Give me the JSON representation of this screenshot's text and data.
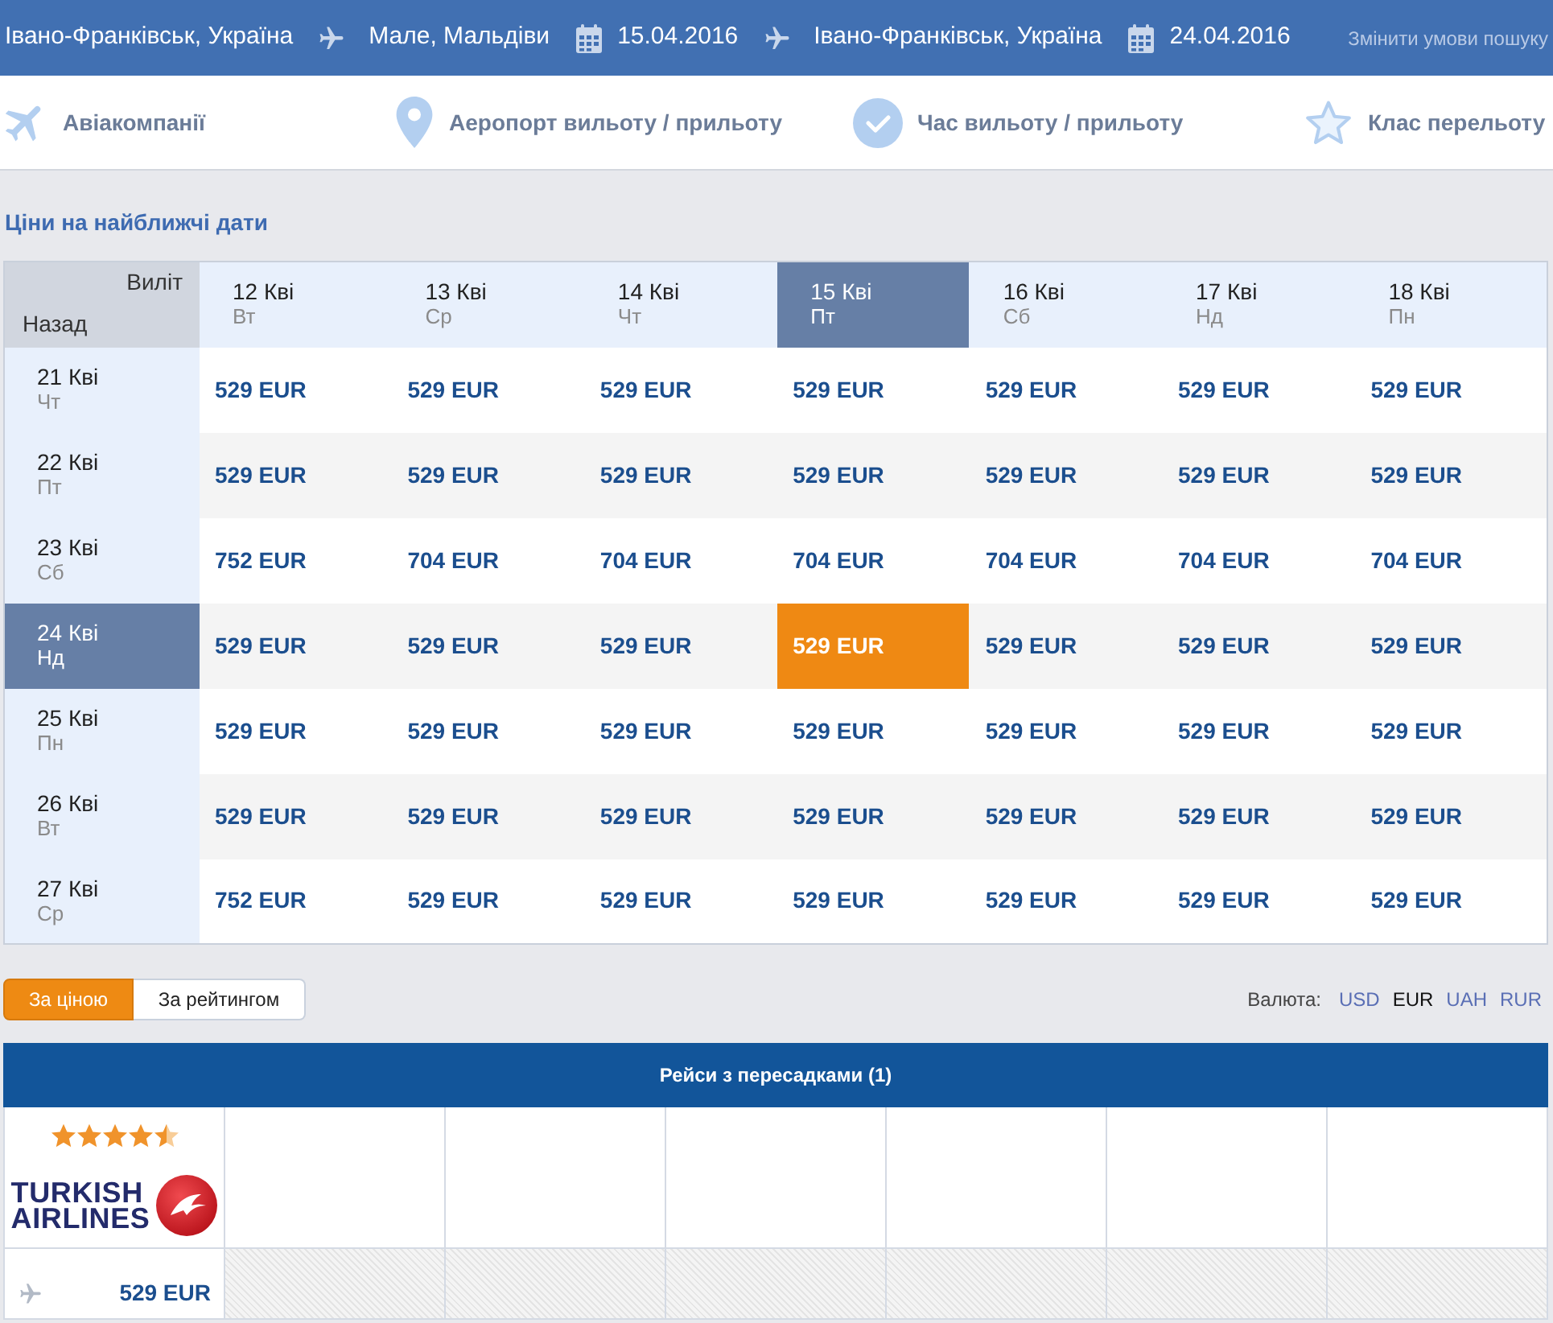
{
  "search_bar": {
    "origin": "Івано-Франківськ, Україна",
    "legs": [
      {
        "destination": "Мале, Мальдіви",
        "date": "15.04.2016"
      },
      {
        "destination": "Івано-Франківськ, Україна",
        "date": "24.04.2016"
      }
    ],
    "change_search": "Змінити умови пошуку"
  },
  "filters": [
    {
      "kind": "plane",
      "label": "Авіакомпанії"
    },
    {
      "kind": "pin",
      "label": "Аеропорт вильоту / прильоту"
    },
    {
      "kind": "check",
      "label": "Час вильоту / прильоту"
    },
    {
      "kind": "star",
      "label": "Клас перельоту"
    }
  ],
  "calendar": {
    "title": "Ціни на найближчі дати",
    "corner_departure": "Виліт",
    "corner_return": "Назад",
    "columns": [
      {
        "date": "12 Кві",
        "weekday": "Вт",
        "selected": false
      },
      {
        "date": "13 Кві",
        "weekday": "Ср",
        "selected": false
      },
      {
        "date": "14 Кві",
        "weekday": "Чт",
        "selected": false
      },
      {
        "date": "15 Кві",
        "weekday": "Пт",
        "selected": true
      },
      {
        "date": "16 Кві",
        "weekday": "Сб",
        "selected": false
      },
      {
        "date": "17 Кві",
        "weekday": "Нд",
        "selected": false
      },
      {
        "date": "18 Кві",
        "weekday": "Пн",
        "selected": false
      }
    ],
    "rows": [
      {
        "date": "21 Кві",
        "weekday": "Чт",
        "selected": false,
        "prices": [
          "529 EUR",
          "529 EUR",
          "529 EUR",
          "529 EUR",
          "529 EUR",
          "529 EUR",
          "529 EUR"
        ]
      },
      {
        "date": "22 Кві",
        "weekday": "Пт",
        "selected": false,
        "prices": [
          "529 EUR",
          "529 EUR",
          "529 EUR",
          "529 EUR",
          "529 EUR",
          "529 EUR",
          "529 EUR"
        ]
      },
      {
        "date": "23 Кві",
        "weekday": "Сб",
        "selected": false,
        "prices": [
          "752 EUR",
          "704 EUR",
          "704 EUR",
          "704 EUR",
          "704 EUR",
          "704 EUR",
          "704 EUR"
        ]
      },
      {
        "date": "24 Кві",
        "weekday": "Нд",
        "selected": true,
        "prices": [
          "529 EUR",
          "529 EUR",
          "529 EUR",
          "529 EUR",
          "529 EUR",
          "529 EUR",
          "529 EUR"
        ]
      },
      {
        "date": "25 Кві",
        "weekday": "Пн",
        "selected": false,
        "prices": [
          "529 EUR",
          "529 EUR",
          "529 EUR",
          "529 EUR",
          "529 EUR",
          "529 EUR",
          "529 EUR"
        ]
      },
      {
        "date": "26 Кві",
        "weekday": "Вт",
        "selected": false,
        "prices": [
          "529 EUR",
          "529 EUR",
          "529 EUR",
          "529 EUR",
          "529 EUR",
          "529 EUR",
          "529 EUR"
        ]
      },
      {
        "date": "27 Кві",
        "weekday": "Ср",
        "selected": false,
        "prices": [
          "752 EUR",
          "529 EUR",
          "529 EUR",
          "529 EUR",
          "529 EUR",
          "529 EUR",
          "529 EUR"
        ]
      }
    ]
  },
  "sort_tabs": [
    {
      "label": "За ціною",
      "selected": true
    },
    {
      "label": "За рейтингом",
      "selected": false
    }
  ],
  "currency": {
    "label": "Валюта:",
    "options": [
      {
        "label": "USD",
        "selected": false
      },
      {
        "label": "EUR",
        "selected": true
      },
      {
        "label": "UAH",
        "selected": false
      },
      {
        "label": "RUR",
        "selected": false
      }
    ]
  },
  "results": {
    "header": "Рейси з пересадками (1)",
    "flights": [
      {
        "stars": 4.5,
        "airline_logo": [
          "TURKISH",
          "AIRLINES"
        ],
        "price": "529 EUR"
      }
    ]
  }
}
